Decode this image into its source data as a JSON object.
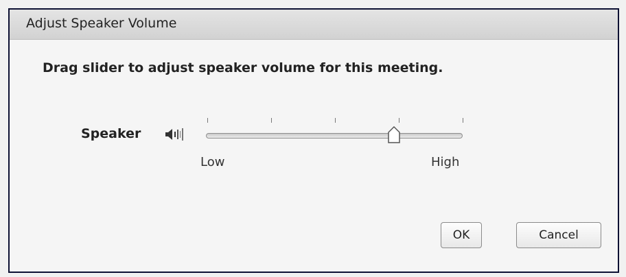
{
  "dialog": {
    "title": "Adjust Speaker Volume",
    "instruction": "Drag slider to adjust speaker volume for this meeting."
  },
  "speaker": {
    "label": "Speaker",
    "icon": "speaker-volume-icon",
    "volume_level": 0.73,
    "tick_count": 5,
    "low_label": "Low",
    "high_label": "High"
  },
  "buttons": {
    "ok_label": "OK",
    "cancel_label": "Cancel"
  },
  "colors": {
    "border": "#0d1033",
    "background": "#f5f5f5"
  }
}
